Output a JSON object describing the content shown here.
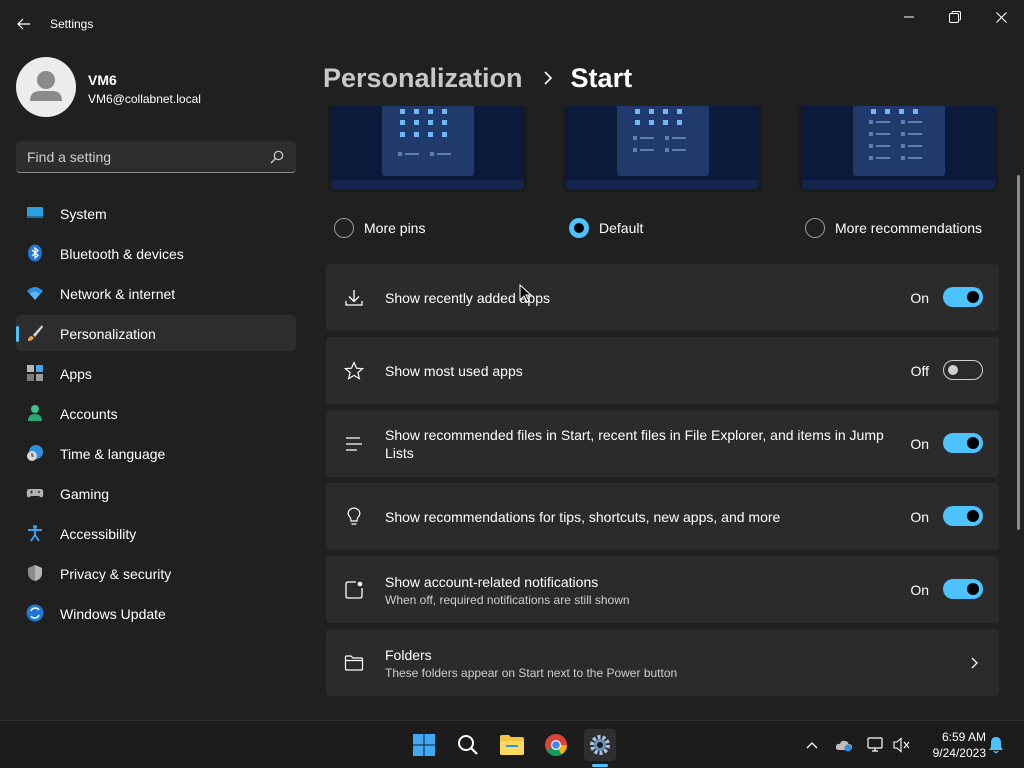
{
  "window": {
    "title": "Settings"
  },
  "profile": {
    "name": "VM6",
    "email": "VM6@collabnet.local"
  },
  "search": {
    "placeholder": "Find a setting"
  },
  "nav": [
    {
      "label": "System",
      "icon": "system-icon",
      "selected": false
    },
    {
      "label": "Bluetooth & devices",
      "icon": "bluetooth-icon",
      "selected": false
    },
    {
      "label": "Network & internet",
      "icon": "wifi-icon",
      "selected": false
    },
    {
      "label": "Personalization",
      "icon": "brush-icon",
      "selected": true
    },
    {
      "label": "Apps",
      "icon": "apps-icon",
      "selected": false
    },
    {
      "label": "Accounts",
      "icon": "accounts-icon",
      "selected": false
    },
    {
      "label": "Time & language",
      "icon": "time-language-icon",
      "selected": false
    },
    {
      "label": "Gaming",
      "icon": "gamepad-icon",
      "selected": false
    },
    {
      "label": "Accessibility",
      "icon": "accessibility-icon",
      "selected": false
    },
    {
      "label": "Privacy & security",
      "icon": "shield-icon",
      "selected": false
    },
    {
      "label": "Windows Update",
      "icon": "update-icon",
      "selected": false
    }
  ],
  "breadcrumb": {
    "parent": "Personalization",
    "current": "Start"
  },
  "layout_options": [
    {
      "label": "More pins",
      "selected": false
    },
    {
      "label": "Default",
      "selected": true
    },
    {
      "label": "More recommendations",
      "selected": false
    }
  ],
  "settings": [
    {
      "title": "Show recently added apps",
      "subtitle": "",
      "state": "On",
      "icon": "download-icon"
    },
    {
      "title": "Show most used apps",
      "subtitle": "",
      "state": "Off",
      "icon": "star-icon"
    },
    {
      "title": "Show recommended files in Start, recent files in File Explorer, and items in Jump Lists",
      "subtitle": "",
      "state": "On",
      "icon": "list-icon"
    },
    {
      "title": "Show recommendations for tips, shortcuts, new apps, and more",
      "subtitle": "",
      "state": "On",
      "icon": "lightbulb-icon"
    },
    {
      "title": "Show account-related notifications",
      "subtitle": "When off, required notifications are still shown",
      "state": "On",
      "icon": "notification-icon"
    }
  ],
  "folders": {
    "title": "Folders",
    "subtitle": "These folders appear on Start next to the Power button",
    "icon": "folder-icon"
  },
  "taskbar": {
    "time": "6:59 AM",
    "date": "9/24/2023",
    "apps": [
      "windows-start-icon",
      "search-icon",
      "file-explorer-icon",
      "chrome-icon",
      "settings-gear-icon"
    ]
  },
  "colors": {
    "accent": "#4cc2ff",
    "background": "#202020",
    "card": "#2b2b2b"
  }
}
